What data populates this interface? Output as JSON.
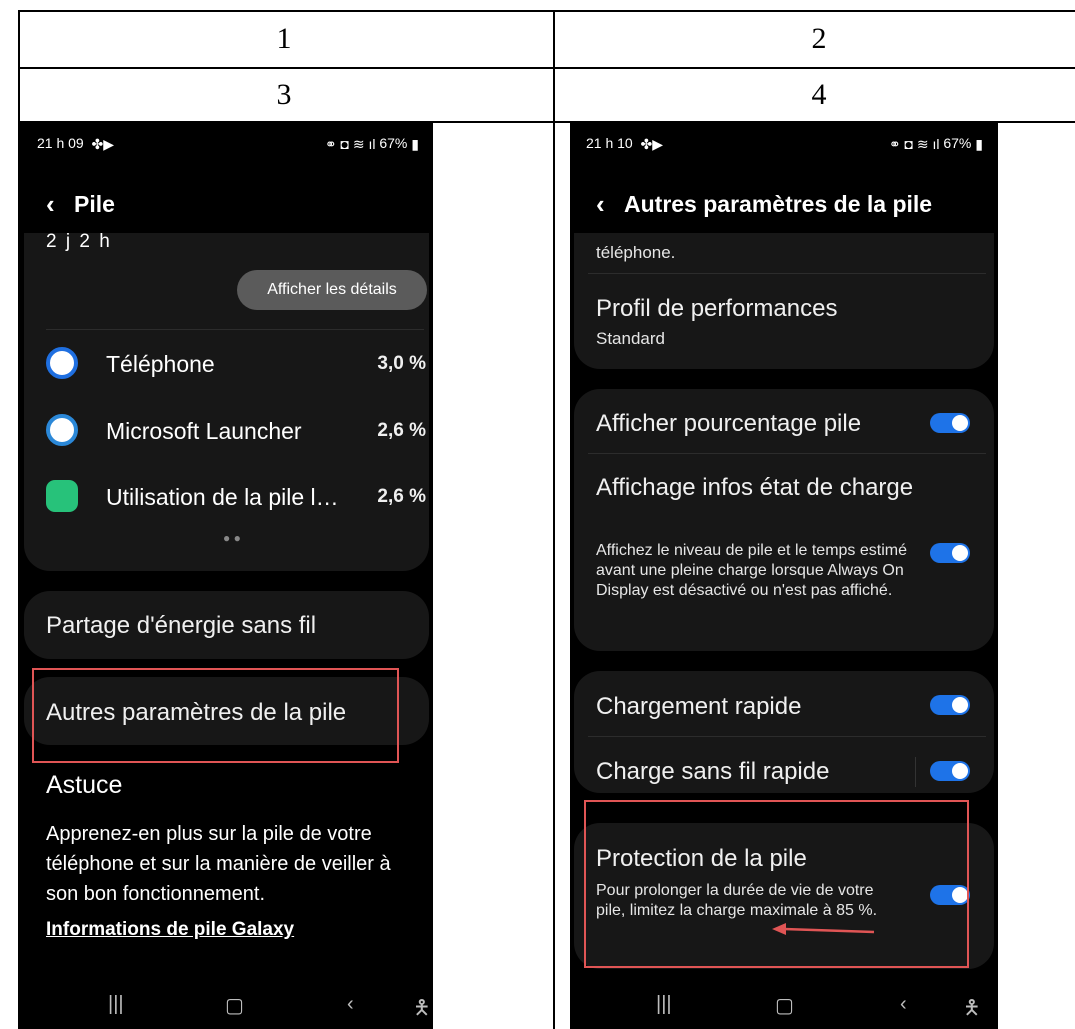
{
  "table": {
    "headers": [
      "1",
      "2",
      "3",
      "4"
    ]
  },
  "left": {
    "status": {
      "time": "21 h 09",
      "battery": "67%"
    },
    "title": "Pile",
    "remaining": "2 j 2 h",
    "details_button": "Afficher les détails",
    "apps": [
      {
        "name": "Téléphone",
        "pct": "3,0 %",
        "icon": "phone-app-icon",
        "color": "#1f6fe0"
      },
      {
        "name": "Microsoft Launcher",
        "pct": "2,6 %",
        "icon": "launcher-app-icon",
        "color": "#2b88d8"
      },
      {
        "name": "Utilisation de la pile l…",
        "pct": "2,6 %",
        "icon": "battery-usage-app-icon",
        "color": "#27c27a"
      }
    ],
    "wireless_share": "Partage d'énergie sans fil",
    "more_settings": "Autres paramètres de la pile",
    "tip_title": "Astuce",
    "tip_text": "Apprenez-en plus sur la pile de votre téléphone et sur la manière de veiller à son bon fonctionnement.",
    "tip_link": "Informations de pile Galaxy"
  },
  "right": {
    "status": {
      "time": "21 h 10",
      "battery": "67%"
    },
    "title": "Autres paramètres de la pile",
    "partial_text": "téléphone.",
    "performance_title": "Profil de performances",
    "performance_value": "Standard",
    "show_percent": "Afficher pourcentage pile",
    "charge_info_title": "Affichage infos état de charge",
    "charge_info_desc": "Affichez le niveau de pile et le temps estimé avant une pleine charge lorsque Always On Display est désactivé ou n'est pas affiché.",
    "fast_charge": "Chargement rapide",
    "fast_wireless": "Charge sans fil rapide",
    "protection_title": "Protection de la pile",
    "protection_desc": "Pour prolonger la durée de vie de votre pile, limitez la charge maximale à 85 %."
  },
  "colors": {
    "toggle_on": "#1e73e8",
    "highlight": "#e05555",
    "card": "#171717"
  }
}
